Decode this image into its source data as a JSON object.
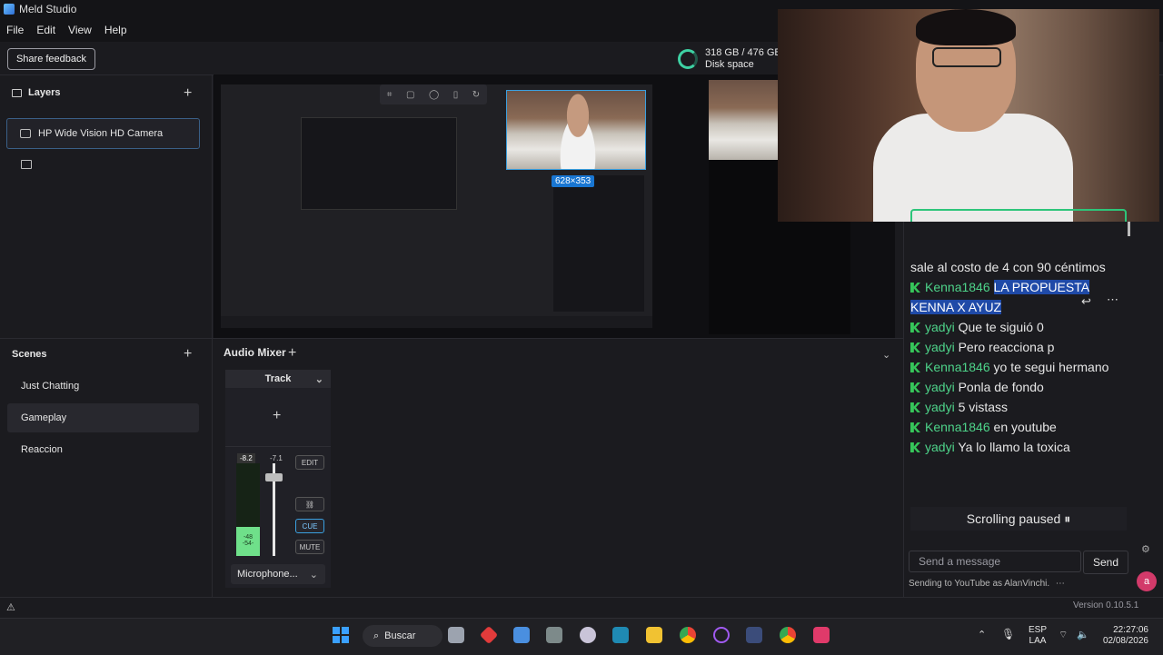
{
  "window": {
    "title": "Meld Studio"
  },
  "menu": {
    "file": "File",
    "edit": "Edit",
    "view": "View",
    "help": "Help"
  },
  "toolbar": {
    "feedback_label": "Share feedback",
    "disk_value": "318 GB / 476 GB",
    "disk_label": "Disk space"
  },
  "layers": {
    "heading": "Layers",
    "items": [
      {
        "label": "HP Wide Vision HD Camera"
      }
    ]
  },
  "scenes": {
    "heading": "Scenes",
    "items": [
      {
        "label": "Just Chatting"
      },
      {
        "label": "Gameplay"
      },
      {
        "label": "Reaccion"
      }
    ]
  },
  "preview": {
    "size_badge": "628×353"
  },
  "audio": {
    "heading": "Audio Mixer",
    "track_label": "Track",
    "meter_db": "-8.2",
    "fader_db": "-7.1",
    "meter_marks": [
      "-48",
      "-54-"
    ],
    "edit_label": "EDIT",
    "cue_label": "CUE",
    "mute_label": "MUTE",
    "source_label": "Microphone..."
  },
  "chat": {
    "messages": [
      {
        "user": "",
        "text": "sale al costo de 4 con 90 céntimos"
      },
      {
        "user": "Kenna1846",
        "text": "LA PROPUESTA KENNA X AYUZ",
        "highlight": true
      },
      {
        "user": "yadyi",
        "text": "Que te siguió 0"
      },
      {
        "user": "yadyi",
        "text": "Pero reacciona p"
      },
      {
        "user": "Kenna1846",
        "text": "yo te segui hermano"
      },
      {
        "user": "yadyi",
        "text": "Ponla de fondo"
      },
      {
        "user": "yadyi",
        "text": "5 vistass"
      },
      {
        "user": "Kenna1846",
        "text": "en youtube"
      },
      {
        "user": "yadyi",
        "text": "Ya lo llamo la toxica"
      }
    ],
    "scroll_status": "Scrolling paused ⏸",
    "input_placeholder": "Send a message",
    "send_label": "Send",
    "sending_to": "Sending to YouTube as AlanVinchi.",
    "avatar_letter": "a"
  },
  "status": {
    "version": "Version 0.10.5.1"
  },
  "taskbar": {
    "search_label": "Buscar",
    "lang_top": "ESP",
    "lang_bottom": "LAA",
    "time": "22:27:06",
    "date": "02/08/2026"
  },
  "colors": {
    "accent": "#3ed1a3",
    "chat_user": "#4ed48a",
    "highlight": "#1f4aa8",
    "cue": "#3aa0e0"
  }
}
